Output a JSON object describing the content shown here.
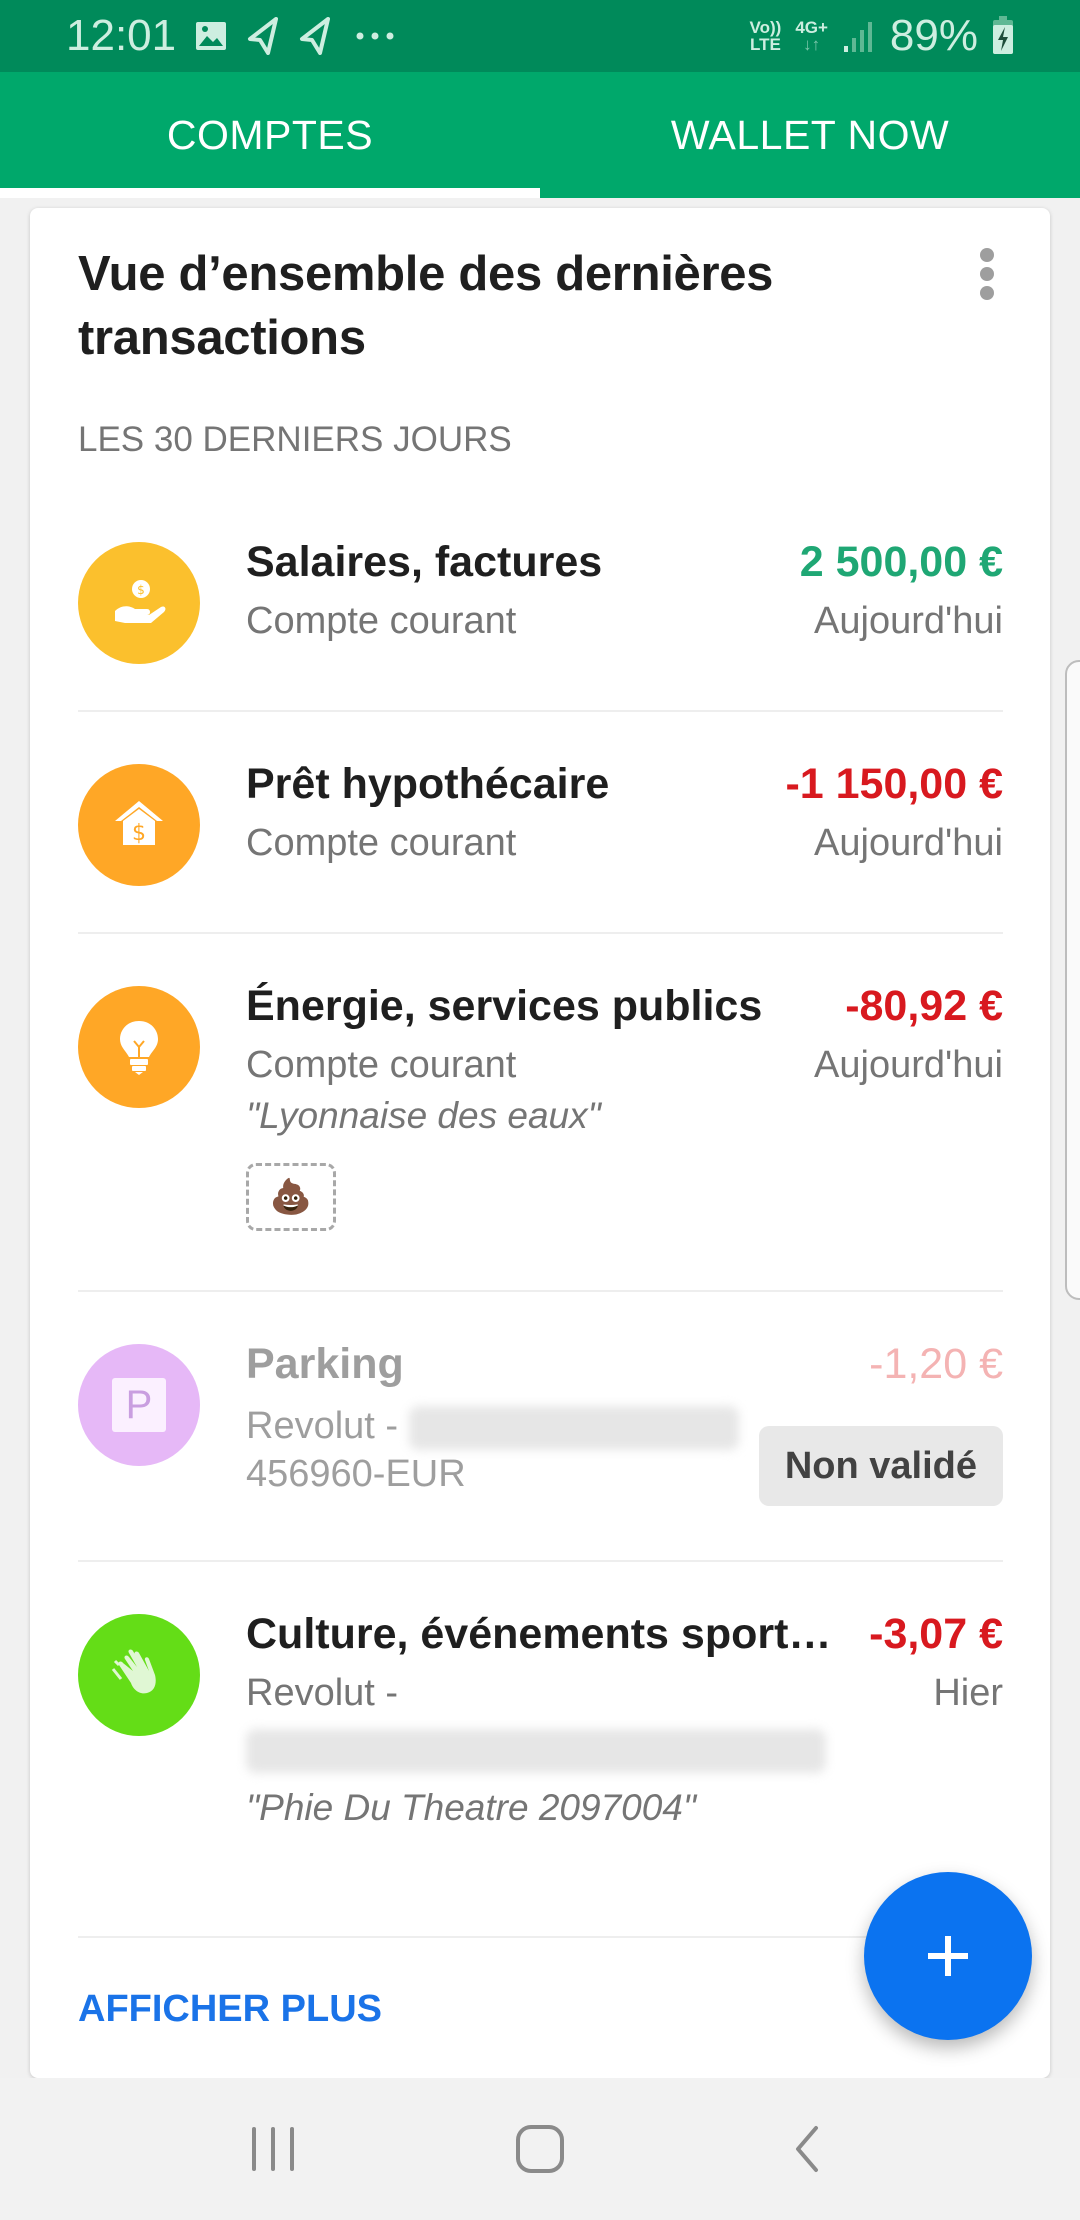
{
  "status_bar": {
    "time": "12:01",
    "notification_icons": [
      "image-icon",
      "telegram-icon",
      "telegram-icon",
      "more-dots"
    ],
    "network_volte": "Vo))",
    "network_lte": "LTE",
    "network_type": "4G+",
    "battery": "89%",
    "battery_charging": true
  },
  "tabs": [
    {
      "label": "COMPTES",
      "active": true
    },
    {
      "label": "WALLET NOW",
      "active": false
    }
  ],
  "card": {
    "title": "Vue d’ensemble des dernières transactions",
    "subheader": "LES 30 DERNIERS JOURS",
    "show_more": "AFFICHER PLUS"
  },
  "transactions": [
    {
      "name": "Salaires, factures",
      "account": "Compte courant",
      "amount": "2 500,00 €",
      "date": "Aujourd'hui",
      "icon": "hand-coin-icon",
      "icon_color": "#fbc02d",
      "amount_color": "#1fa774"
    },
    {
      "name": "Prêt hypothécaire",
      "account": "Compte courant",
      "amount": "-1 150,00 €",
      "date": "Aujourd'hui",
      "icon": "house-dollar-icon",
      "icon_color": "#ffa726",
      "amount_color": "#d8191f"
    },
    {
      "name": "Énergie, services publics",
      "account": "Compte courant",
      "amount": "-80,92 €",
      "date": "Aujourd'hui",
      "note": "\"Lyonnaise des eaux\"",
      "attachment_emoji": "💩",
      "icon": "lightbulb-icon",
      "icon_color": "#ffa726",
      "amount_color": "#d8191f"
    },
    {
      "name": "Parking",
      "account_prefix": "Revolut -",
      "account_suffix": "456960-EUR",
      "amount": "-1,20 €",
      "status_badge": "Non validé",
      "icon": "parking-icon",
      "icon_letter": "P",
      "icon_color": "#e6b8f7",
      "amount_color": "#f4b3b3"
    },
    {
      "name": "Culture, événements sport…",
      "account_prefix": "Revolut -",
      "amount": "-3,07 €",
      "date": "Hier",
      "note": "\"Phie Du Theatre 2097004\"",
      "icon": "clapping-hands-icon",
      "icon_color": "#64dd17",
      "amount_color": "#d8191f"
    }
  ],
  "fab": {
    "icon": "plus-icon",
    "color": "#0b73f0"
  },
  "nav_bar": [
    "recent-apps",
    "home",
    "back"
  ]
}
